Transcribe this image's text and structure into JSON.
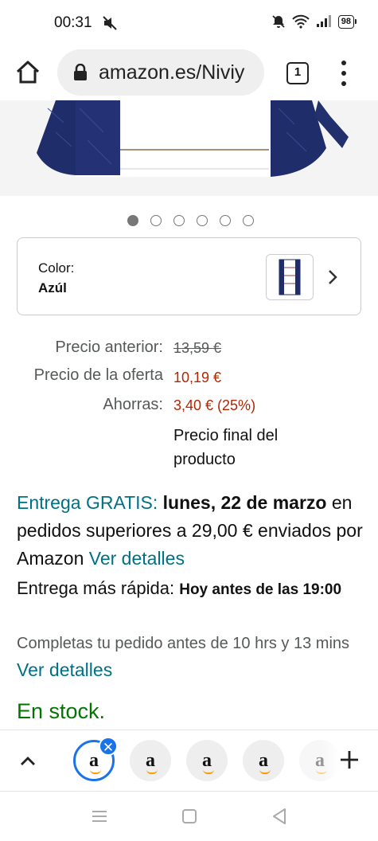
{
  "status": {
    "time": "00:31",
    "battery": "98"
  },
  "browser": {
    "url": "amazon.es/Niviy",
    "tab_count": "1"
  },
  "gallery": {
    "total_images": 6,
    "current_index": 1
  },
  "color": {
    "label": "Color:",
    "value": "Azúl"
  },
  "prices": {
    "previous_label": "Precio anterior:",
    "previous_value": "13,59 €",
    "deal_label": "Precio de la oferta",
    "deal_value": "10,19 €",
    "savings_label": "Ahorras:",
    "savings_value": "3,40 € (25%)",
    "final_note": "Precio final del producto"
  },
  "delivery": {
    "free_label": "Entrega GRATIS:",
    "free_date": "lunes, 22 de marzo",
    "free_condition": "en pedidos superiores a 29,00 € enviados por Amazon",
    "details_link": "Ver detalles",
    "fast_label": "Entrega más rápida:",
    "fast_date": "Hoy antes de las 19:00",
    "cutoff_text": "Completas tu pedido antes de 10 hrs y 13 mins",
    "cutoff_link": "Ver detalles"
  },
  "stock": "En stock.",
  "tab_strip": {
    "tab_letter": "a",
    "close": "✕",
    "new_tab": "+"
  },
  "colors": {
    "teal": "#007185",
    "price_red": "#B12704",
    "stock_green": "#007600",
    "chrome_blue": "#1A73E8"
  }
}
